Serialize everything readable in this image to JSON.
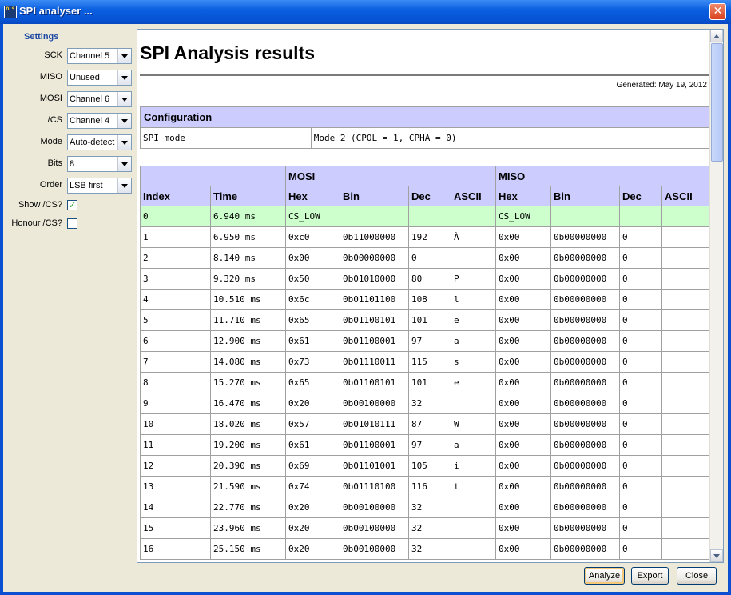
{
  "window": {
    "title": "SPI analyser ...",
    "icon_text": "OLS",
    "close_symbol": "✕"
  },
  "settings": {
    "header": "Settings",
    "rows": [
      {
        "label": "SCK",
        "value": "Channel 5"
      },
      {
        "label": "MISO",
        "value": "Unused"
      },
      {
        "label": "MOSI",
        "value": "Channel 6"
      },
      {
        "label": "/CS",
        "value": "Channel 4"
      },
      {
        "label": "Mode",
        "value": "Auto-detect"
      },
      {
        "label": "Bits",
        "value": "8"
      },
      {
        "label": "Order",
        "value": "LSB first"
      }
    ],
    "show_cs": {
      "label": "Show /CS?",
      "checked": true,
      "mark": "✓"
    },
    "honour_cs": {
      "label": "Honour /CS?",
      "checked": false,
      "mark": ""
    }
  },
  "report": {
    "title": "SPI Analysis results",
    "generated": "Generated: May 19, 2012",
    "config": {
      "header": "Configuration",
      "rows": [
        {
          "key": "SPI mode",
          "value": "Mode 2 (CPOL = 1, CPHA = 0)"
        }
      ]
    },
    "table": {
      "group_headers": {
        "mosi": "MOSI",
        "miso": "MISO"
      },
      "columns": [
        "Index",
        "Time",
        "Hex",
        "Bin",
        "Dec",
        "ASCII",
        "Hex",
        "Bin",
        "Dec",
        "ASCII"
      ],
      "rows": [
        [
          "0",
          "6.940 ms",
          "CS_LOW",
          "",
          "",
          "",
          "CS_LOW",
          "",
          "",
          ""
        ],
        [
          "1",
          "6.950 ms",
          "0xc0",
          "0b11000000",
          "192",
          "À",
          "0x00",
          "0b00000000",
          "0",
          ""
        ],
        [
          "2",
          "8.140 ms",
          "0x00",
          "0b00000000",
          "0",
          "",
          "0x00",
          "0b00000000",
          "0",
          ""
        ],
        [
          "3",
          "9.320 ms",
          "0x50",
          "0b01010000",
          "80",
          "P",
          "0x00",
          "0b00000000",
          "0",
          ""
        ],
        [
          "4",
          "10.510 ms",
          "0x6c",
          "0b01101100",
          "108",
          "l",
          "0x00",
          "0b00000000",
          "0",
          ""
        ],
        [
          "5",
          "11.710 ms",
          "0x65",
          "0b01100101",
          "101",
          "e",
          "0x00",
          "0b00000000",
          "0",
          ""
        ],
        [
          "6",
          "12.900 ms",
          "0x61",
          "0b01100001",
          "97",
          "a",
          "0x00",
          "0b00000000",
          "0",
          ""
        ],
        [
          "7",
          "14.080 ms",
          "0x73",
          "0b01110011",
          "115",
          "s",
          "0x00",
          "0b00000000",
          "0",
          ""
        ],
        [
          "8",
          "15.270 ms",
          "0x65",
          "0b01100101",
          "101",
          "e",
          "0x00",
          "0b00000000",
          "0",
          ""
        ],
        [
          "9",
          "16.470 ms",
          "0x20",
          "0b00100000",
          "32",
          "",
          "0x00",
          "0b00000000",
          "0",
          ""
        ],
        [
          "10",
          "18.020 ms",
          "0x57",
          "0b01010111",
          "87",
          "W",
          "0x00",
          "0b00000000",
          "0",
          ""
        ],
        [
          "11",
          "19.200 ms",
          "0x61",
          "0b01100001",
          "97",
          "a",
          "0x00",
          "0b00000000",
          "0",
          ""
        ],
        [
          "12",
          "20.390 ms",
          "0x69",
          "0b01101001",
          "105",
          "i",
          "0x00",
          "0b00000000",
          "0",
          ""
        ],
        [
          "13",
          "21.590 ms",
          "0x74",
          "0b01110100",
          "116",
          "t",
          "0x00",
          "0b00000000",
          "0",
          ""
        ],
        [
          "14",
          "22.770 ms",
          "0x20",
          "0b00100000",
          "32",
          "",
          "0x00",
          "0b00000000",
          "0",
          ""
        ],
        [
          "15",
          "23.960 ms",
          "0x20",
          "0b00100000",
          "32",
          "",
          "0x00",
          "0b00000000",
          "0",
          ""
        ],
        [
          "16",
          "25.150 ms",
          "0x20",
          "0b00100000",
          "32",
          "",
          "0x00",
          "0b00000000",
          "0",
          ""
        ]
      ]
    }
  },
  "buttons": {
    "analyze": "Analyze",
    "export": "Export",
    "close": "Close"
  }
}
